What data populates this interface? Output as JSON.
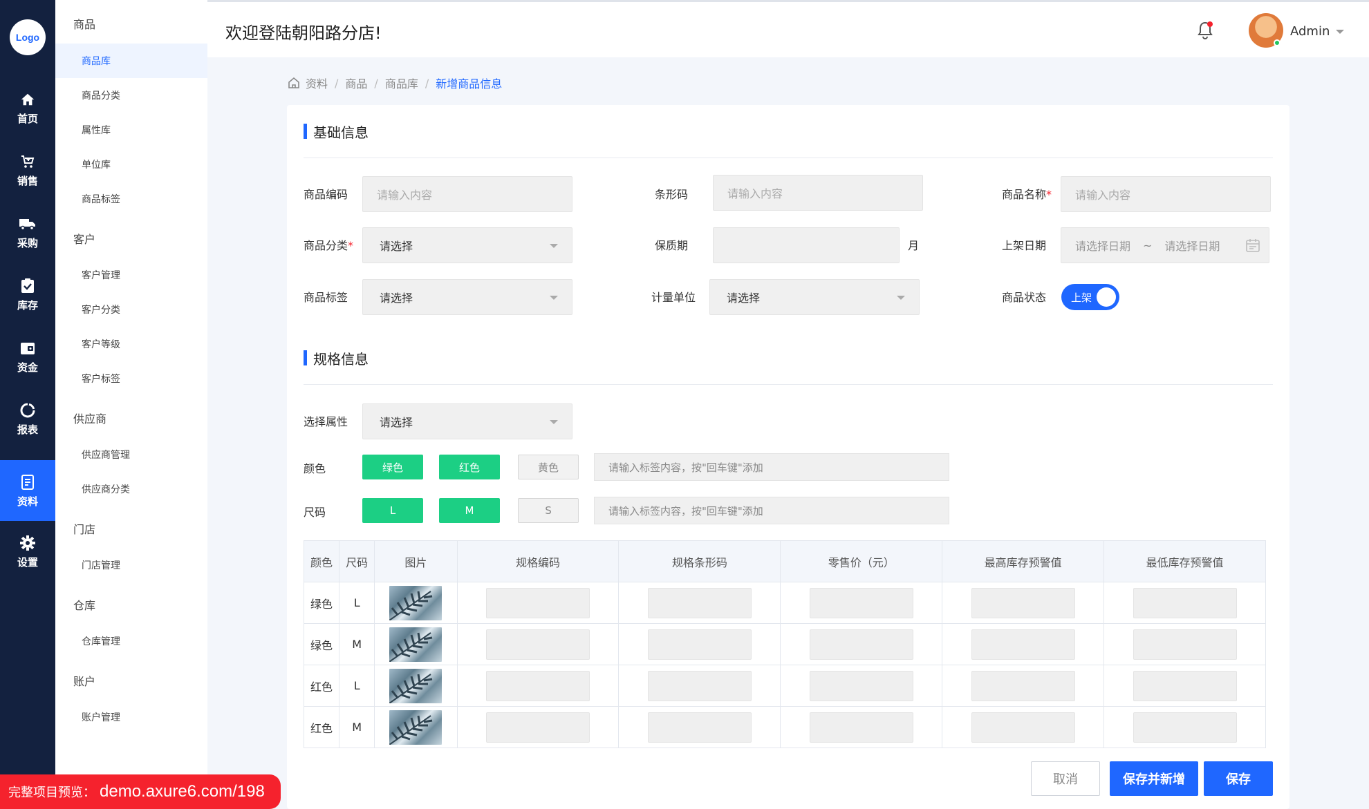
{
  "logo": "Logo",
  "rail": [
    {
      "label": "首页",
      "icon": "home-icon"
    },
    {
      "label": "销售",
      "icon": "cart-icon"
    },
    {
      "label": "采购",
      "icon": "truck-icon"
    },
    {
      "label": "库存",
      "icon": "clipboard-check-icon"
    },
    {
      "label": "资金",
      "icon": "wallet-icon"
    },
    {
      "label": "报表",
      "icon": "chart-ring-icon"
    },
    {
      "label": "资料",
      "icon": "document-icon",
      "active": true
    },
    {
      "label": "设置",
      "icon": "gear-icon"
    }
  ],
  "submenu": {
    "groups": [
      {
        "title": "商品",
        "items": [
          "商品库",
          "商品分类",
          "属性库",
          "单位库",
          "商品标签"
        ]
      },
      {
        "title": "客户",
        "items": [
          "客户管理",
          "客户分类",
          "客户等级",
          "客户标签"
        ]
      },
      {
        "title": "供应商",
        "items": [
          "供应商管理",
          "供应商分类"
        ]
      },
      {
        "title": "门店",
        "items": [
          "门店管理"
        ]
      },
      {
        "title": "仓库",
        "items": [
          "仓库管理"
        ]
      },
      {
        "title": "账户",
        "items": [
          "账户管理"
        ]
      }
    ]
  },
  "header": {
    "welcome": "欢迎登陆朝阳路分店!",
    "user": "Admin"
  },
  "breadcrumb": [
    "资料",
    "商品",
    "商品库",
    "新增商品信息"
  ],
  "basic": {
    "title": "基础信息",
    "code_label": "商品编码",
    "code_placeholder": "请输入内容",
    "barcode_label": "条形码",
    "barcode_placeholder": "请输入内容",
    "name_label": "商品名称",
    "name_placeholder": "请输入内容",
    "category_label": "商品分类",
    "category_value": "请选择",
    "shelf_label": "保质期",
    "shelf_unit": "月",
    "date_label": "上架日期",
    "date_start": "请选择日期",
    "date_sep": "~",
    "date_end": "请选择日期",
    "tag_label": "商品标签",
    "tag_value": "请选择",
    "unit_label": "计量单位",
    "unit_value": "请选择",
    "status_label": "商品状态",
    "status_value": "上架",
    "required_mark": "*"
  },
  "spec": {
    "title": "规格信息",
    "attr_label": "选择属性",
    "attr_value": "请选择",
    "color_label": "颜色",
    "colors": [
      "绿色",
      "红色",
      "黄色"
    ],
    "size_label": "尺码",
    "sizes": [
      "L",
      "M",
      "S"
    ],
    "tag_input_placeholder": "请输入标签内容，按\"回车键\"添加"
  },
  "table": {
    "headers": [
      "颜色",
      "尺码",
      "图片",
      "规格编码",
      "规格条形码",
      "零售价（元）",
      "最高库存预警值",
      "最低库存预警值"
    ],
    "rows": [
      {
        "color": "绿色",
        "size": "L"
      },
      {
        "color": "绿色",
        "size": "M"
      },
      {
        "color": "红色",
        "size": "L"
      },
      {
        "color": "红色",
        "size": "M"
      }
    ]
  },
  "buttons": {
    "cancel": "取消",
    "save_new": "保存并新增",
    "save": "保存"
  },
  "promo": {
    "prefix": "完整项目预览：",
    "url": "demo.axure6.com/198"
  },
  "colors": {
    "primary": "#1f67ff",
    "rail_bg": "#13213f",
    "tag_green": "#1ccf84",
    "promo_red": "#f5222d"
  }
}
